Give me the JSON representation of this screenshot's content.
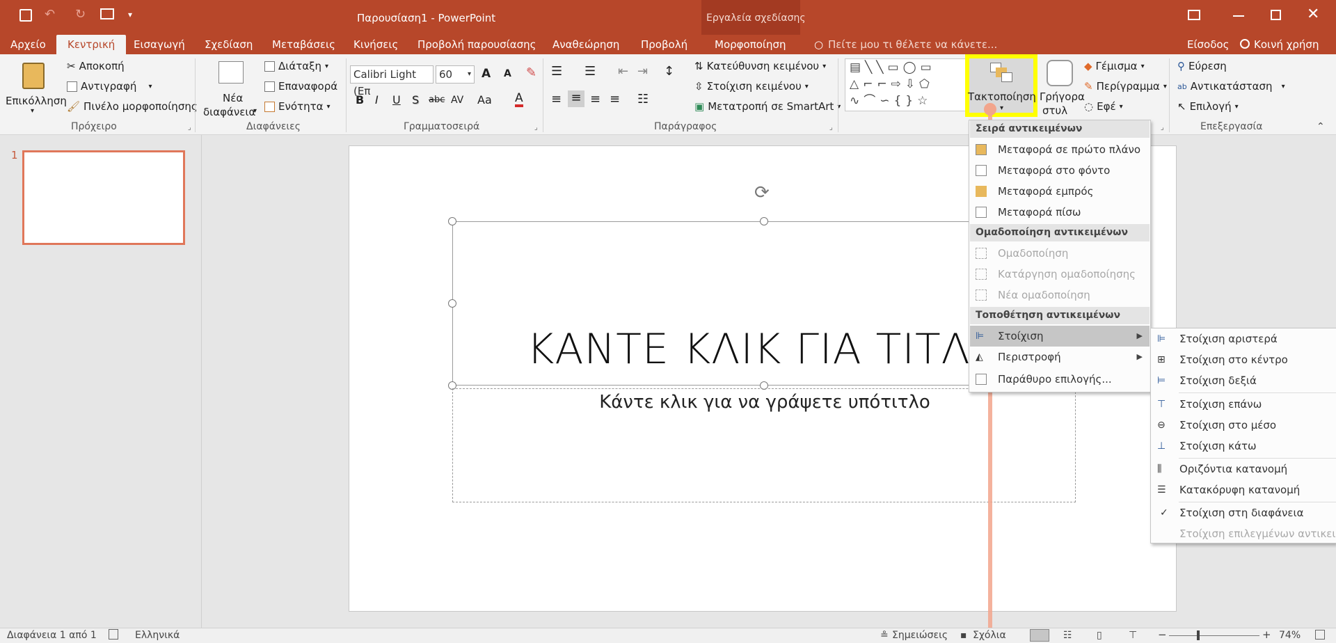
{
  "window": {
    "title": "Παρουσίαση1 - PowerPoint",
    "context_group": "Εργαλεία σχεδίασης",
    "signin": "Είσοδος",
    "share": "Κοινή χρήση"
  },
  "tabs": [
    "Αρχείο",
    "Κεντρική",
    "Εισαγωγή",
    "Σχεδίαση",
    "Μεταβάσεις",
    "Κινήσεις",
    "Προβολή παρουσίασης",
    "Αναθεώρηση",
    "Προβολή",
    "Μορφοποίηση"
  ],
  "tellme": "Πείτε μου τι θέλετε να κάνετε...",
  "ribbon": {
    "clipboard": {
      "paste": "Επικόλληση",
      "cut": "Αποκοπή",
      "copy": "Αντιγραφή",
      "painter": "Πινέλο μορφοποίησης",
      "label": "Πρόχειρο"
    },
    "slides": {
      "new_slide_1": "Νέα",
      "new_slide_2": "διαφάνεια",
      "layout": "Διάταξη",
      "reset": "Επαναφορά",
      "section": "Ενότητα",
      "label": "Διαφάνειες"
    },
    "font": {
      "name": "Calibri Light (Επ",
      "size": "60",
      "bold": "B",
      "italic": "I",
      "underline": "U",
      "shadow": "S",
      "strike": "abc",
      "spacing": "AV",
      "case": "Aa",
      "color": "A",
      "grow": "A",
      "shrink": "A",
      "label": "Γραμματοσειρά"
    },
    "paragraph": {
      "direction": "Κατεύθυνση κειμένου",
      "align_text": "Στοίχιση κειμένου",
      "smartart": "Μετατροπή σε SmartArt",
      "label": "Παράγραφος"
    },
    "drawing": {
      "arrange_1": "Τακτοποίηση",
      "quick_1": "Γρήγορα",
      "quick_2": "στυλ",
      "fill": "Γέμισμα",
      "outline": "Περίγραμμα",
      "effects": "Εφέ"
    },
    "editing": {
      "find": "Εύρεση",
      "replace": "Αντικατάσταση",
      "select": "Επιλογή",
      "label": "Επεξεργασία"
    }
  },
  "thumbnail": {
    "number": "1"
  },
  "slide": {
    "title": "ΚΑΝΤΕ ΚΛΙΚ ΓΙΑ ΤΙΤΛΟ",
    "subtitle": "Κάντε κλικ για να γράψετε υπότιτλο"
  },
  "arrange_menu": {
    "order_header": "Σειρά αντικειμένων",
    "order_items": [
      "Μεταφορά σε πρώτο πλάνο",
      "Μεταφορά στο φόντο",
      "Μεταφορά εμπρός",
      "Μεταφορά πίσω"
    ],
    "group_header": "Ομαδοποίηση αντικειμένων",
    "group_items": [
      "Ομαδοποίηση",
      "Κατάργηση ομαδοποίησης",
      "Νέα ομαδοποίηση"
    ],
    "position_header": "Τοποθέτηση αντικειμένων",
    "position_items": [
      "Στοίχιση",
      "Περιστροφή",
      "Παράθυρο επιλογής..."
    ]
  },
  "align_submenu": [
    "Στοίχιση αριστερά",
    "Στοίχιση στο κέντρο",
    "Στοίχιση δεξιά",
    "Στοίχιση επάνω",
    "Στοίχιση στο μέσο",
    "Στοίχιση κάτω",
    "Οριζόντια κατανομή",
    "Κατακόρυφη κατανομή",
    "Στοίχιση στη διαφάνεια",
    "Στοίχιση επιλεγμένων αντικειμένων"
  ],
  "status": {
    "slide": "Διαφάνεια 1 από 1",
    "language": "Ελληνικά",
    "notes": "Σημειώσεις",
    "comments": "Σχόλια",
    "zoom": "74%"
  },
  "colors": {
    "accent": "#b7472a",
    "highlight": "#ffff00"
  }
}
